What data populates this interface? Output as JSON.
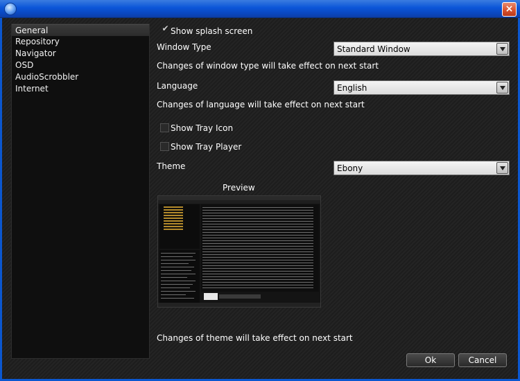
{
  "window": {
    "close_glyph": "×"
  },
  "sidebar": {
    "items": [
      {
        "label": "General",
        "selected": true
      },
      {
        "label": "Repository"
      },
      {
        "label": "Navigator"
      },
      {
        "label": "OSD"
      },
      {
        "label": "AudioScrobbler"
      },
      {
        "label": "Internet"
      }
    ]
  },
  "general": {
    "splash": {
      "label": "Show splash screen",
      "checked": true,
      "check_glyph": "✔"
    },
    "window_type": {
      "label": "Window Type",
      "value": "Standard Window",
      "note": "Changes of window type will take effect on next start"
    },
    "language": {
      "label": "Language",
      "value": "English",
      "note": "Changes of language will take effect on next start"
    },
    "tray_icon": {
      "label": "Show Tray Icon",
      "checked": false
    },
    "tray_player": {
      "label": "Show Tray Player",
      "checked": false
    },
    "theme": {
      "label": "Theme",
      "value": "Ebony",
      "note": "Changes of theme will take effect on next start"
    },
    "preview": {
      "label": "Preview"
    }
  },
  "buttons": {
    "ok": "Ok",
    "cancel": "Cancel"
  },
  "colors": {
    "titlebar": "#0b55d8",
    "background": "#1b1b1b",
    "sidebar": "#0f0f0f",
    "close_button": "#d9532f"
  },
  "icons": {
    "app": "app-icon",
    "close": "close-icon",
    "check": "check-icon",
    "dropdown": "chevron-down-icon"
  }
}
